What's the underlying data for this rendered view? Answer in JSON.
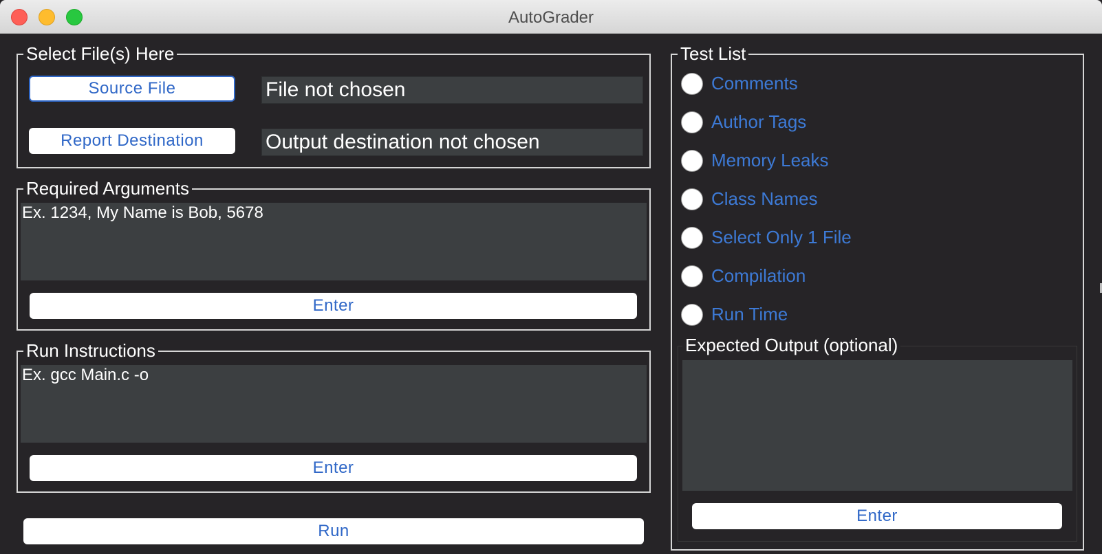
{
  "window": {
    "title": "AutoGrader"
  },
  "select_files": {
    "legend": "Select File(s) Here",
    "source_button": "Source File",
    "source_status": "File not chosen",
    "report_button": "Report Destination",
    "report_status": "Output destination not chosen"
  },
  "required_arguments": {
    "legend": "Required Arguments",
    "text": "Ex. 1234, My Name is Bob, 5678",
    "enter_label": "Enter"
  },
  "run_instructions": {
    "legend": "Run Instructions",
    "text": "Ex. gcc Main.c -o",
    "enter_label": "Enter"
  },
  "run_button": "Run",
  "test_list": {
    "legend": "Test List",
    "items": [
      {
        "label": "Comments",
        "selected": false
      },
      {
        "label": "Author Tags",
        "selected": false
      },
      {
        "label": "Memory Leaks",
        "selected": false
      },
      {
        "label": "Class Names",
        "selected": false
      },
      {
        "label": "Select Only 1 File",
        "selected": false
      },
      {
        "label": "Compilation",
        "selected": false
      },
      {
        "label": "Run Time",
        "selected": false
      }
    ],
    "expected_output": {
      "legend": "Expected Output (optional)",
      "text": "",
      "enter_label": "Enter"
    }
  },
  "colors": {
    "background": "#262427",
    "field": "#3c3f41",
    "accent_text": "#2f67c7",
    "radio_label": "#3d7ad6",
    "border": "#d6d6d6"
  }
}
